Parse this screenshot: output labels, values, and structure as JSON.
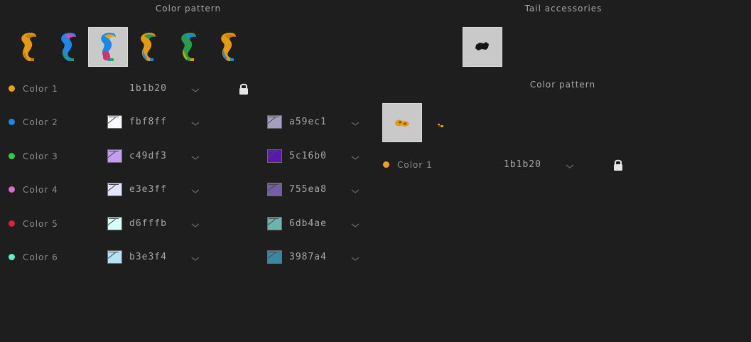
{
  "left_panel": {
    "title": "Color pattern",
    "patterns": [
      {
        "name": "tail-pattern-1",
        "colors": [
          "#e49b12",
          "#c97f0a"
        ],
        "selected": false
      },
      {
        "name": "tail-pattern-2",
        "colors": [
          "#1e88e5",
          "#d04bb8",
          "#2a9d4a"
        ],
        "selected": false
      },
      {
        "name": "tail-pattern-3",
        "colors": [
          "#1e88e5",
          "#f0a014",
          "#2da84e",
          "#d6306e"
        ],
        "selected": true
      },
      {
        "name": "tail-pattern-4",
        "colors": [
          "#e49b12",
          "#2a9d4a",
          "#1e88e5"
        ],
        "selected": false
      },
      {
        "name": "tail-pattern-5",
        "colors": [
          "#2a9d4a",
          "#1e88e5",
          "#e49b12"
        ],
        "selected": false
      },
      {
        "name": "tail-pattern-6",
        "colors": [
          "#e49b12",
          "#c97f0a",
          "#1e88e5"
        ],
        "selected": false
      }
    ],
    "rows": [
      {
        "label": "Color 1",
        "dot": "#f0a014",
        "hex1": "1b1b20",
        "swatch1": null,
        "locked": true,
        "hex2": "",
        "swatch2": null
      },
      {
        "label": "Color 2",
        "dot": "#1e88e5",
        "hex1": "fbf8ff",
        "swatch1": "#fbf8ff",
        "locked": false,
        "hex2": "a59ec1",
        "swatch2": "#a59ec1"
      },
      {
        "label": "Color 3",
        "dot": "#2ecc40",
        "hex1": "c49df3",
        "swatch1": "#c49df3",
        "locked": false,
        "hex2": "5c16b0",
        "swatch2": "#5c16b0"
      },
      {
        "label": "Color 4",
        "dot": "#d86bd0",
        "hex1": "e3e3ff",
        "swatch1": "#e3e3ff",
        "locked": false,
        "hex2": "755ea8",
        "swatch2": "#755ea8"
      },
      {
        "label": "Color 5",
        "dot": "#dc1f3c",
        "hex1": "d6fffb",
        "swatch1": "#d6fffb",
        "locked": false,
        "hex2": "6db4ae",
        "swatch2": "#6db4ae"
      },
      {
        "label": "Color 6",
        "dot": "#5ff0c8",
        "hex1": "b3e3f4",
        "swatch1": "#b3e3f4",
        "locked": false,
        "hex2": "3987a4",
        "swatch2": "#3987a4"
      }
    ]
  },
  "right_panel": {
    "title": "Tail accessories",
    "accessory_color": "#151515",
    "sub_title": "Color pattern",
    "sub_pattern_color": "#e49b12",
    "rows": [
      {
        "label": "Color 1",
        "dot": "#f0a014",
        "hex1": "1b1b20",
        "locked": true
      }
    ]
  },
  "icons": {
    "chevron": "chevron-down-icon",
    "lock": "lock-icon",
    "accessory": "accessory-icon"
  }
}
